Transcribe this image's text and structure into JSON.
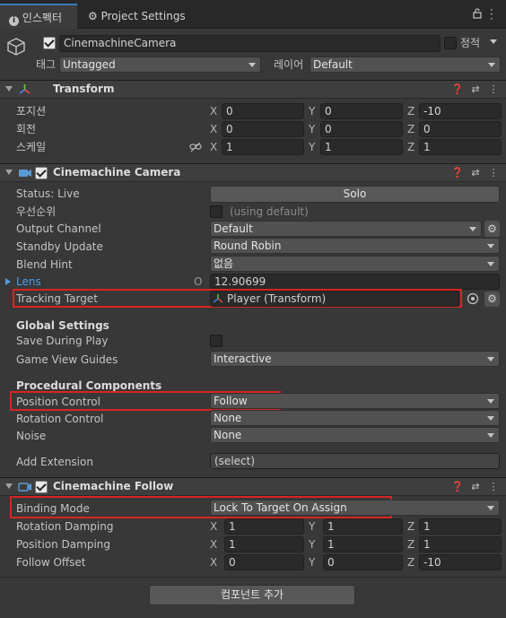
{
  "tabs": [
    {
      "label": "인스펙터",
      "icon": "info-icon"
    },
    {
      "label": "Project Settings",
      "icon": "gear-icon"
    }
  ],
  "object": {
    "name": "CinemachineCamera",
    "static_label": "정적",
    "tag_label": "태그",
    "tag_value": "Untagged",
    "layer_label": "레이어",
    "layer_value": "Default"
  },
  "transform": {
    "title": "Transform",
    "rows": [
      {
        "label": "포지션",
        "x": "0",
        "y": "0",
        "z": "-10"
      },
      {
        "label": "회전",
        "x": "0",
        "y": "0",
        "z": "0"
      },
      {
        "label": "스케일",
        "x": "1",
        "y": "1",
        "z": "1"
      }
    ]
  },
  "axes": {
    "x": "X",
    "y": "Y",
    "z": "Z"
  },
  "cm_camera": {
    "title": "Cinemachine Camera",
    "status_label": "Status: Live",
    "solo_label": "Solo",
    "priority_label": "우선순위",
    "priority_hint": "(using default)",
    "output_channel_label": "Output Channel",
    "output_channel_value": "Default",
    "standby_label": "Standby Update",
    "standby_value": "Round Robin",
    "blend_label": "Blend Hint",
    "blend_value": "없음",
    "lens_label": "Lens",
    "lens_value": "12.90699",
    "tracking_label": "Tracking Target",
    "tracking_value": "Player (Transform)",
    "global_settings": "Global Settings",
    "save_label": "Save During Play",
    "guides_label": "Game View Guides",
    "guides_value": "Interactive",
    "procedural": "Procedural Components",
    "position_label": "Position Control",
    "position_value": "Follow",
    "rotation_label": "Rotation Control",
    "rotation_value": "None",
    "noise_label": "Noise",
    "noise_value": "None",
    "extension_label": "Add Extension",
    "extension_value": "(select)"
  },
  "cm_follow": {
    "title": "Cinemachine Follow",
    "binding_label": "Binding Mode",
    "binding_value": "Lock To Target On Assign",
    "rows": [
      {
        "label": "Rotation Damping",
        "x": "1",
        "y": "1",
        "z": "1"
      },
      {
        "label": "Position Damping",
        "x": "1",
        "y": "1",
        "z": "1"
      },
      {
        "label": "Follow Offset",
        "x": "0",
        "y": "0",
        "z": "-10"
      }
    ]
  },
  "add_component": "컴포넌트 추가",
  "colors": {
    "highlight": "#d62424",
    "accent": "#3a79bb",
    "lens_blue": "#4a9ee8"
  }
}
